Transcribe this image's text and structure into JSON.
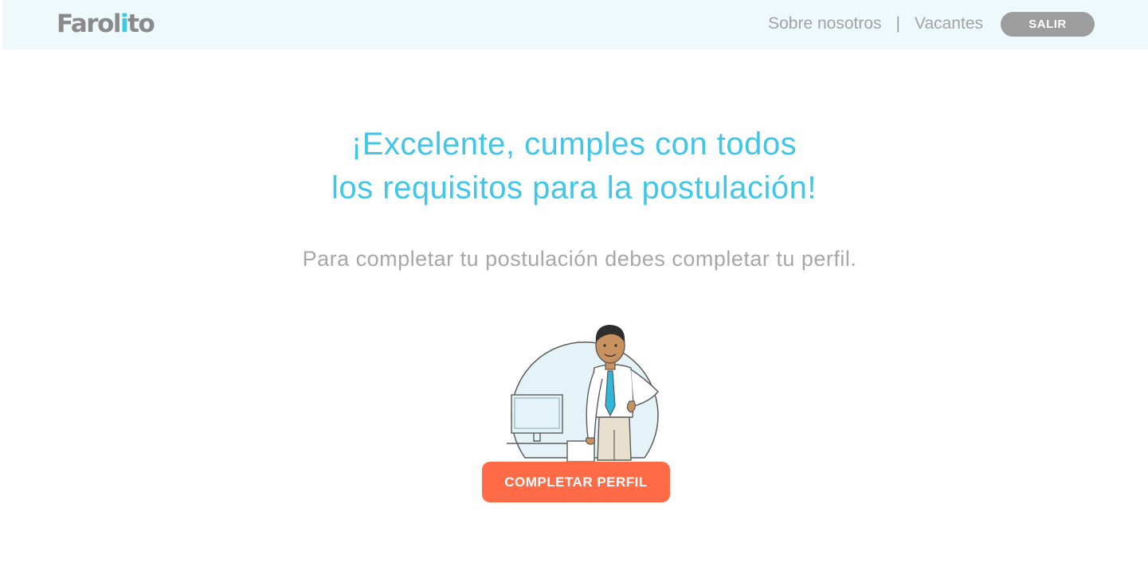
{
  "header": {
    "logo_main": "Farol",
    "logo_accent": "i",
    "logo_end": "to",
    "nav": {
      "about": "Sobre nosotros",
      "separator": "|",
      "jobs": "Vacantes",
      "logout": "SALIR"
    }
  },
  "main": {
    "headline_line1": "¡Excelente, cumples con todos",
    "headline_line2": "los requisitos para la postulación!",
    "subtext": "Para completar tu postulación debes completar tu perfil.",
    "cta_label": "COMPLETAR PERFIL"
  },
  "colors": {
    "accent": "#3fc6e8",
    "cta": "#ff6a47",
    "header_bg": "#eef9fc",
    "logout_bg": "#9d9d9d"
  }
}
